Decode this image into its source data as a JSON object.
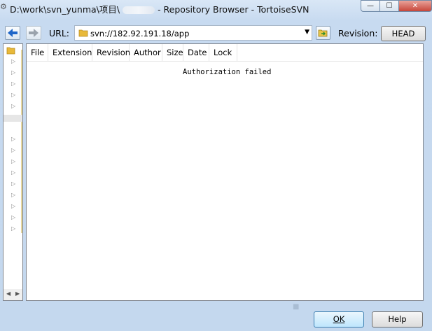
{
  "window": {
    "title_prefix": "D:\\work\\svn_yunma\\项目\\",
    "title_suffix": "- Repository Browser - TortoiseSVN",
    "minimize": "—",
    "maximize": "☐",
    "close": "✕"
  },
  "toolbar": {
    "url_label": "URL:",
    "url_value": "svn://182.92.191.18/app",
    "revision_label": "Revision:",
    "revision_button": "HEAD"
  },
  "list": {
    "columns": [
      "File",
      "Extension",
      "Revision",
      "Author",
      "Size",
      "Date",
      "Lock"
    ],
    "message": "Authorization failed"
  },
  "buttons": {
    "ok": "OK",
    "help": "Help"
  },
  "colors": {
    "accent": "#2a6fcf",
    "folder": "#e8b93a"
  }
}
